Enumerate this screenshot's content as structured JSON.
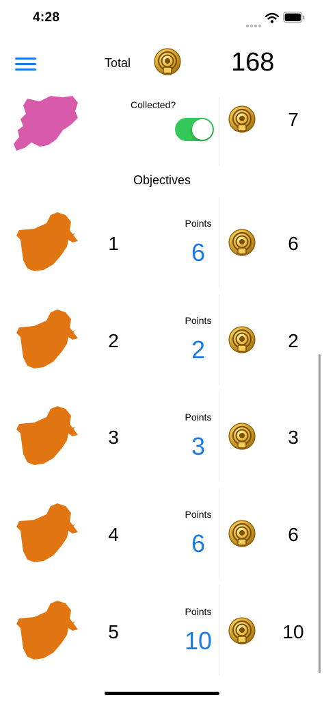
{
  "status_bar": {
    "time": "4:28"
  },
  "header": {
    "total_label": "Total",
    "total_value": "168"
  },
  "collectible": {
    "label": "Collected?",
    "collected": true,
    "value": "7"
  },
  "section": {
    "title": "Objectives"
  },
  "objectives": [
    {
      "number": "1",
      "points_label": "Points",
      "points": "6",
      "value": "6"
    },
    {
      "number": "2",
      "points_label": "Points",
      "points": "2",
      "value": "2"
    },
    {
      "number": "3",
      "points_label": "Points",
      "points": "3",
      "value": "3"
    },
    {
      "number": "4",
      "points_label": "Points",
      "points": "6",
      "value": "6"
    },
    {
      "number": "5",
      "points_label": "Points",
      "points": "10",
      "value": "10"
    }
  ],
  "colors": {
    "accent": "#1b7be6",
    "toggle_on": "#34c759",
    "bird_orange": "#e07511",
    "bird_pink": "#d85aab"
  },
  "icons": [
    "hamburger-menu-icon",
    "coin-icon",
    "wifi-icon",
    "battery-icon",
    "bird-silhouette-icon",
    "pink-bird-silhouette-icon"
  ]
}
